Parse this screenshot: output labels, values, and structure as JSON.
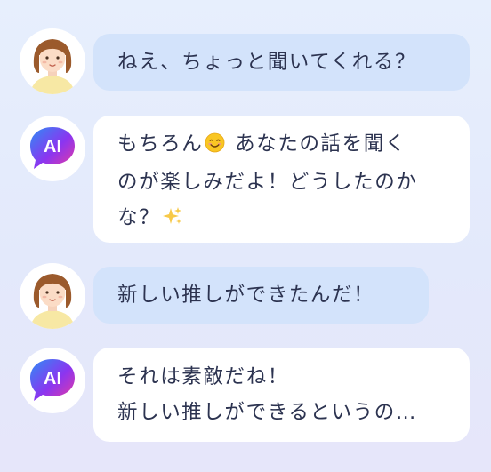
{
  "conversation": {
    "messages": [
      {
        "sender": "user",
        "avatar": "woman-avatar-icon",
        "lines": [
          "ねえ、ちょっと聞いてくれる？"
        ]
      },
      {
        "sender": "ai",
        "avatar": "ai-chat-bubble-icon",
        "avatar_label": "AI",
        "lines": [
          "もちろん",
          " あなたの話を聞く",
          "のが楽しみだよ！どうしたのか",
          "な？"
        ],
        "emojis": [
          "smiling-face-emoji",
          "sparkles-emoji"
        ]
      },
      {
        "sender": "user",
        "avatar": "woman-avatar-icon",
        "lines": [
          "新しい推しができたんだ！"
        ]
      },
      {
        "sender": "ai",
        "avatar": "ai-chat-bubble-icon",
        "avatar_label": "AI",
        "lines": [
          "それは素敵だね！",
          "新しい推しができるというの…"
        ]
      }
    ]
  },
  "colors": {
    "user_bubble": "#d3e3fb",
    "ai_bubble": "#ffffff",
    "text": "#2c3350",
    "ai_icon_gradient": [
      "#2e8df5",
      "#8b35f0",
      "#e93ba0"
    ]
  }
}
